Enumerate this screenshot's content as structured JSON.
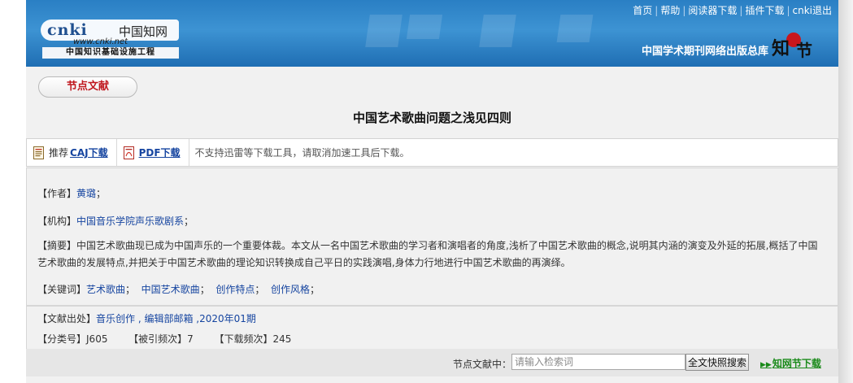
{
  "header": {
    "top_links": [
      "首页",
      "帮助",
      "阅读器下载",
      "插件下载",
      "cnki退出"
    ],
    "publisher": "中国学术期刊网络出版总库",
    "logo": {
      "brand": "cnki",
      "brand_cn": "中国知网",
      "url": "www.cnki.net",
      "tagline": "中国知识基础设施工程"
    },
    "mark": "知网节"
  },
  "section_tag": "节点文献",
  "title": "中国艺术歌曲问题之浅见四则",
  "downloads": {
    "recommend_label": "推荐",
    "caj_link": "CAJ下载",
    "pdf_link": "PDF下载",
    "note": "不支持迅雷等下载工具，请取消加速工具后下载。"
  },
  "meta": {
    "author_label": "【作者】",
    "author": "黄璐",
    "institution_label": "【机构】",
    "institution": "中国音乐学院声乐歌剧系",
    "abstract_label": "【摘要】",
    "abstract": "中国艺术歌曲现已成为中国声乐的一个重要体裁。本文从一名中国艺术歌曲的学习者和演唱者的角度,浅析了中国艺术歌曲的概念,说明其内涵的演变及外延的拓展,概括了中国艺术歌曲的发展特点,并把关于中国艺术歌曲的理论知识转换成自己平日的实践演唱,身体力行地进行中国艺术歌曲的再演绎。",
    "keywords_label": "【关键词】",
    "keywords": [
      "艺术歌曲",
      "中国艺术歌曲",
      "创作特点",
      "创作风格"
    ]
  },
  "source": {
    "source_label": "【文献出处】",
    "source": "音乐创作 , 编辑部邮箱 ,2020年01期",
    "class_label": "【分类号】",
    "class_value": "J605",
    "cited_label": "【被引频次】",
    "cited_value": "7",
    "download_label": "【下载频次】",
    "download_value": "245"
  },
  "search": {
    "label": "节点文献中：",
    "placeholder": "请输入检索词",
    "button": "全文快照搜索",
    "cnki_download": "知网节下载"
  }
}
